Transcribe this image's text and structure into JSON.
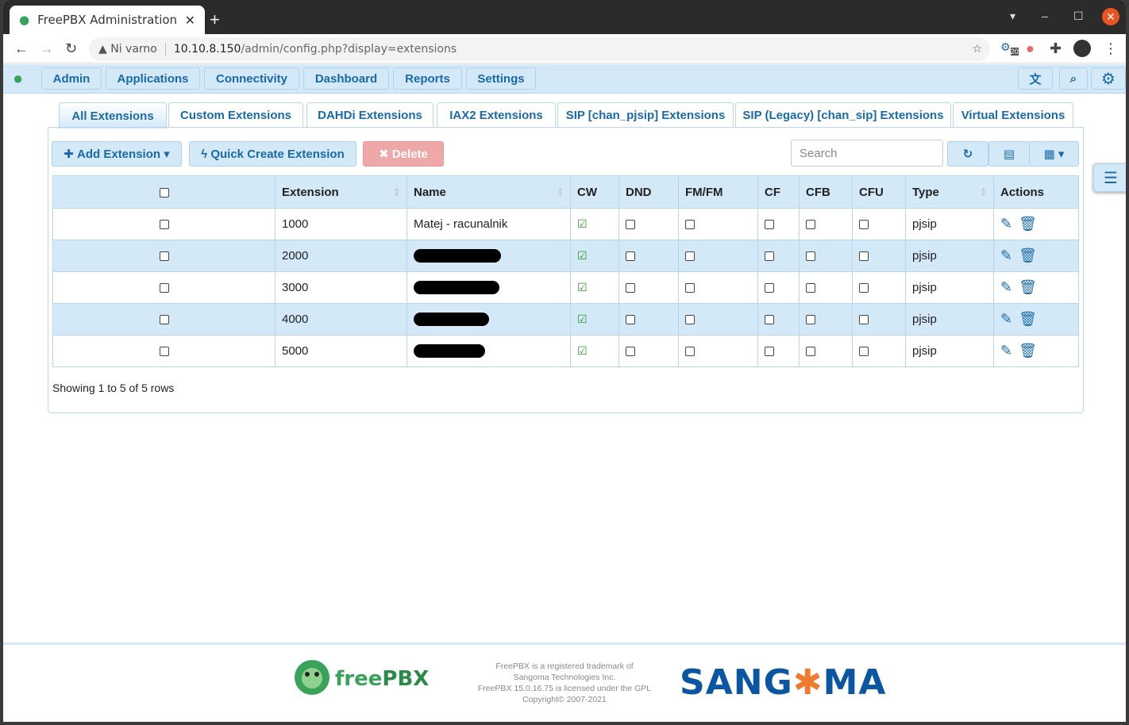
{
  "browser": {
    "tab_title": "FreePBX Administration",
    "security": "Ni varno",
    "url_host": "10.10.8.150",
    "url_path": "/admin/config.php?display=extensions",
    "ext_badge": "20"
  },
  "nav": {
    "items": [
      "Admin",
      "Applications",
      "Connectivity",
      "Dashboard",
      "Reports",
      "Settings"
    ]
  },
  "tabs": [
    "All Extensions",
    "Custom Extensions",
    "DAHDi Extensions",
    "IAX2 Extensions",
    "SIP [chan_pjsip] Extensions",
    "SIP (Legacy) [chan_sip] Extensions",
    "Virtual Extensions"
  ],
  "toolbar": {
    "add": "Add Extension",
    "quick": "Quick Create Extension",
    "delete": "Delete",
    "search_placeholder": "Search"
  },
  "table": {
    "headers": [
      "",
      "Extension",
      "Name",
      "CW",
      "DND",
      "FM/FM",
      "CF",
      "CFB",
      "CFU",
      "Type",
      "Actions"
    ],
    "rows": [
      {
        "ext": "1000",
        "name": "Matej - racunalnik",
        "cw": true,
        "type": "pjsip"
      },
      {
        "ext": "2000",
        "name": "",
        "cw": true,
        "type": "pjsip"
      },
      {
        "ext": "3000",
        "name": "",
        "cw": true,
        "type": "pjsip"
      },
      {
        "ext": "4000",
        "name": "",
        "cw": true,
        "type": "pjsip"
      },
      {
        "ext": "5000",
        "name": "",
        "cw": true,
        "type": "pjsip"
      }
    ]
  },
  "status": "Showing 1 to 5 of 5 rows",
  "footer": {
    "line1": "FreePBX is a registered trademark of",
    "line2": "Sangoma Technologies Inc.",
    "line3": "FreePBX 15.0.16.75 is licensed under the GPL",
    "line4": "Copyright© 2007-2021",
    "freepbx_logo": "freePBX",
    "sangoma_logo": "SANGOMA"
  },
  "colors": {
    "accent": "#1a6aa8",
    "nav_bg": "#d4e9f8",
    "delete": "#eea8a8"
  }
}
